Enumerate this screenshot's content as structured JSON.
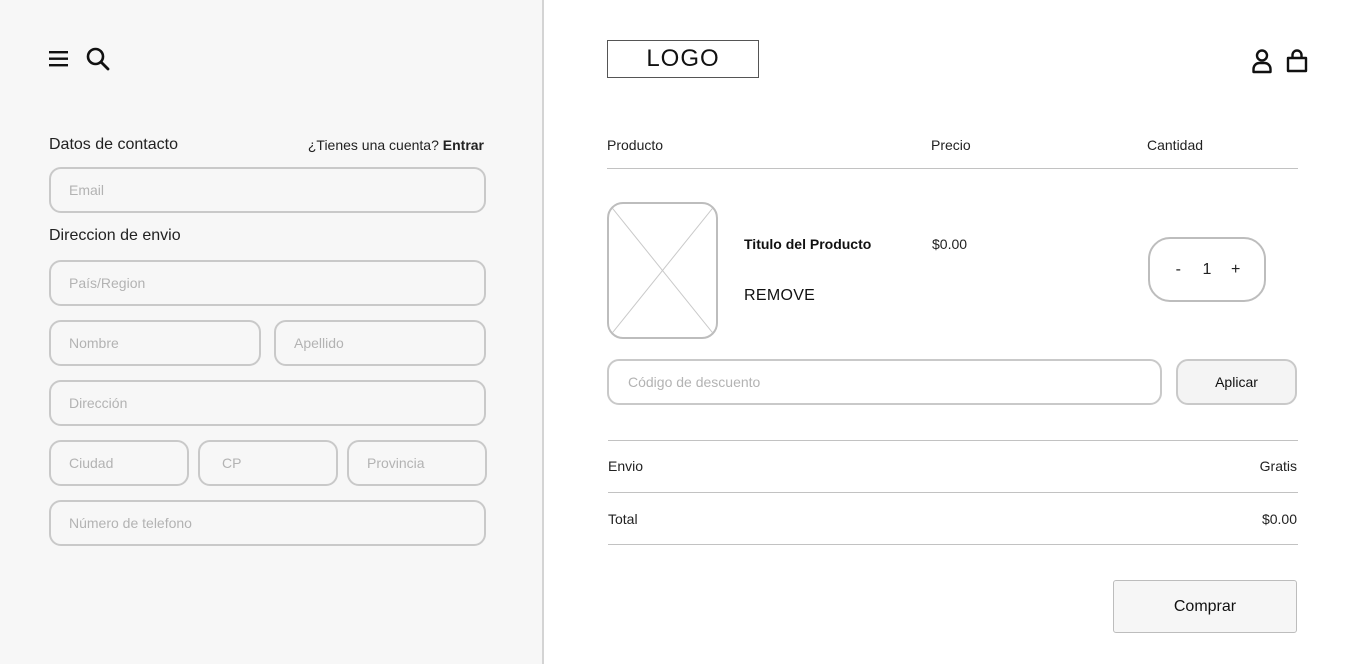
{
  "left": {
    "contact_label": "Datos de contacto",
    "account_prompt": "¿Tienes una cuenta?",
    "login_link": "Entrar",
    "email_placeholder": "Email",
    "shipping_label": "Direccion de envio",
    "country_placeholder": "País/Region",
    "first_name_placeholder": "Nombre",
    "last_name_placeholder": "Apellido",
    "address_placeholder": "Dirección",
    "city_placeholder": "Ciudad",
    "zip_placeholder": "CP",
    "province_placeholder": "Provincia",
    "phone_placeholder": "Número de telefono",
    "icons": [
      "menu-icon",
      "search-icon"
    ]
  },
  "right": {
    "logo": "LOGO",
    "icons": [
      "user-icon",
      "shopping-bag-icon"
    ],
    "table_headers": {
      "product": "Producto",
      "price": "Precio",
      "quantity": "Cantidad"
    },
    "item": {
      "title": "Titulo del Producto",
      "remove": "REMOVE",
      "price": "$0.00",
      "qty_minus": "-",
      "qty_value": "1",
      "qty_plus": "+"
    },
    "discount_placeholder": "Código de descuento",
    "apply_label": "Aplicar",
    "shipping_label": "Envio",
    "shipping_value": "Gratis",
    "total_label": "Total",
    "total_value": "$0.00",
    "buy_label": "Comprar"
  }
}
